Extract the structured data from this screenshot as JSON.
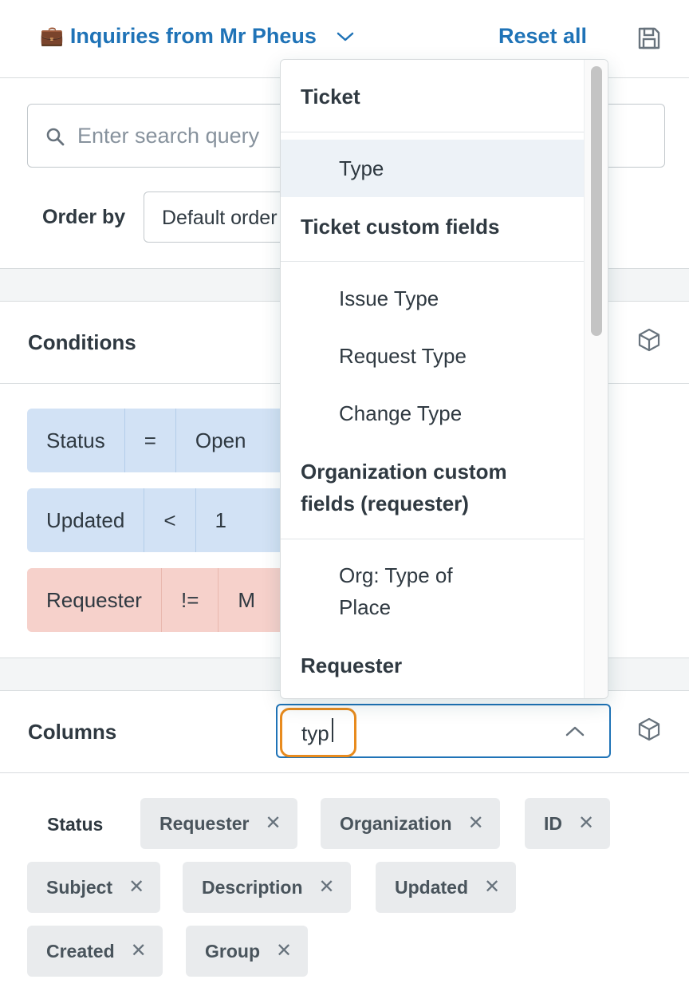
{
  "header": {
    "view_icon": "briefcase-icon",
    "view_icon_glyph": "💼",
    "view_title": "Inquiries from Mr Pheus",
    "reset_label": "Reset all",
    "save_icon": "save-icon"
  },
  "search": {
    "placeholder": "Enter search query"
  },
  "order": {
    "label": "Order by",
    "value": "Default order"
  },
  "conditions": {
    "title": "Conditions",
    "rows": [
      {
        "field": "Status",
        "op": "=",
        "value": "Open",
        "color": "#d2e2f5"
      },
      {
        "field": "Updated",
        "op": "<",
        "value": "1",
        "color": "#d2e2f5"
      },
      {
        "field": "Requester",
        "op": "!=",
        "value": "M",
        "color": "#f6d1cb"
      }
    ]
  },
  "columns": {
    "title": "Columns",
    "input_value": "typ",
    "tags": [
      {
        "label": "Status",
        "removable": false
      },
      {
        "label": "Requester",
        "removable": true
      },
      {
        "label": "Organization",
        "removable": true
      },
      {
        "label": "ID",
        "removable": true
      },
      {
        "label": "Subject",
        "removable": true
      },
      {
        "label": "Description",
        "removable": true
      },
      {
        "label": "Updated",
        "removable": true
      },
      {
        "label": "Created",
        "removable": true
      },
      {
        "label": "Group",
        "removable": true
      }
    ],
    "remove_glyph": "✕"
  },
  "dropdown": {
    "groups": [
      {
        "label": "Ticket",
        "items": [
          "Type"
        ]
      },
      {
        "label": "Ticket custom fields",
        "items": [
          "Issue Type",
          "Request Type",
          "Change Type"
        ]
      },
      {
        "label_lines": [
          "Organization custom",
          "fields (requester)"
        ],
        "items_lines": [
          [
            "Org: Type of",
            "Place"
          ]
        ]
      },
      {
        "label": "Requester",
        "items": []
      }
    ],
    "highlighted_item": "Type"
  },
  "colors": {
    "accent": "#1f73b7",
    "focus_ring": "#e88b1e",
    "condition_blue": "#d2e2f5",
    "condition_red": "#f6d1cb"
  }
}
